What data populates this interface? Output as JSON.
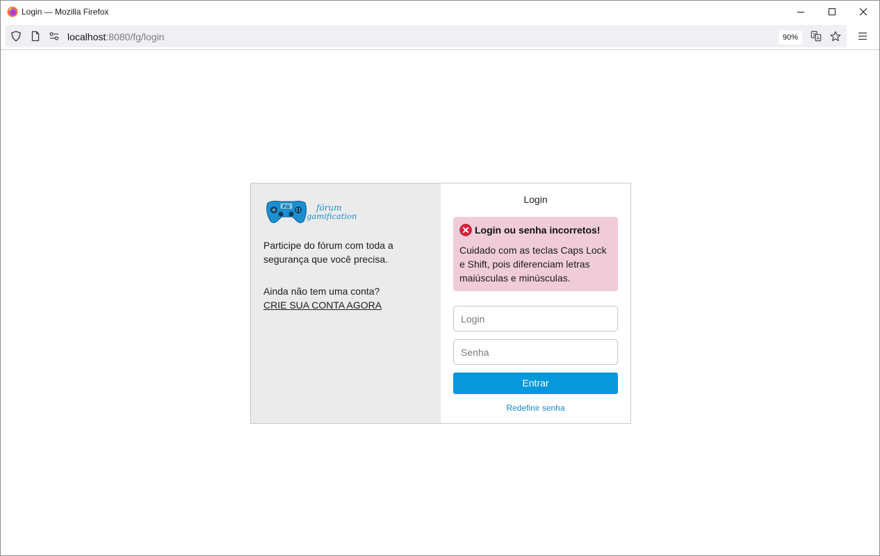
{
  "window": {
    "title": "Login — Mozilla Firefox"
  },
  "navbar": {
    "url_host": "localhost",
    "url_rest": ":8080/fg/login",
    "zoom": "90%"
  },
  "brand": {
    "logo_badge": "FG",
    "logo_line1": "fórum",
    "logo_line2": "gamification"
  },
  "left_panel": {
    "intro": "Participe do fórum com toda a segurança que você precisa.",
    "no_account": "Ainda não tem uma conta?",
    "signup_link": "CRIE SUA CONTA AGORA"
  },
  "login_form": {
    "heading": "Login",
    "alert_title": "Login ou senha incorretos!",
    "alert_body": "Cuidado com as teclas Caps Lock e Shift, pois diferenciam letras maiúsculas e minúsculas.",
    "login_placeholder": "Login",
    "login_value": "",
    "password_placeholder": "Senha",
    "password_value": "",
    "submit_label": "Entrar",
    "reset_link": "Redefinir senha"
  },
  "colors": {
    "accent_button": "#0798dc",
    "alert_bg": "#f0ccd9",
    "link": "#1a86c8",
    "left_panel_bg": "#ebebeb",
    "logo_blue": "#1c8fd1"
  },
  "icons": [
    "firefox-logo",
    "minimize-icon",
    "maximize-icon",
    "close-icon",
    "shield-icon",
    "page-icon",
    "permissions-icon",
    "translate-icon",
    "star-icon",
    "menu-icon",
    "gamepad-logo",
    "error-icon"
  ]
}
